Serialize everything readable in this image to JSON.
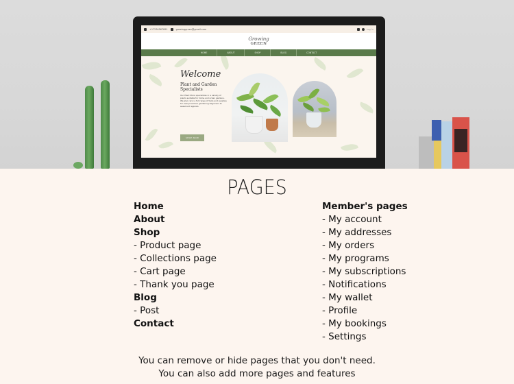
{
  "mockup": {
    "site": {
      "topbar": {
        "phone": "+17234567891",
        "email": "growinggreen@gmail.com",
        "login": "Log In"
      },
      "logo": {
        "script": "Growing",
        "word": "GREEN"
      },
      "nav": [
        "HOME",
        "ABOUT",
        "SHOP",
        "BLOG",
        "CONTACT"
      ],
      "hero": {
        "welcome": "Welcome",
        "subtitle": "Plant and Garden Specialists",
        "body": "Our Plant Store specializes in a variety of plants suitable for home and urban gardens. We also carry a full range of tools and supplies for everyone from gardening beginners to seasoned regulars.",
        "button": "SHOP NOW"
      },
      "colors": {
        "nav_green": "#5a7a4a",
        "button_sage": "#9aa982",
        "background_cream": "#fbf5ee"
      }
    }
  },
  "pages_title": "PAGES",
  "left_column": [
    {
      "label": "Home",
      "bold": true
    },
    {
      "label": "About",
      "bold": true
    },
    {
      "label": "Shop",
      "bold": true
    },
    {
      "label": "- Product page",
      "bold": false
    },
    {
      "label": "- Collections page",
      "bold": false
    },
    {
      "label": "- Cart page",
      "bold": false
    },
    {
      "label": "- Thank you page",
      "bold": false
    },
    {
      "label": "Blog",
      "bold": true
    },
    {
      "label": "- Post",
      "bold": false
    },
    {
      "label": "Contact",
      "bold": true
    }
  ],
  "right_column": [
    {
      "label": "Member's pages",
      "bold": true
    },
    {
      "label": "- My account",
      "bold": false
    },
    {
      "label": "- My addresses",
      "bold": false
    },
    {
      "label": "- My orders",
      "bold": false
    },
    {
      "label": "- My programs",
      "bold": false
    },
    {
      "label": "- My subscriptions",
      "bold": false
    },
    {
      "label": "- Notifications",
      "bold": false
    },
    {
      "label": "- My wallet",
      "bold": false
    },
    {
      "label": "- Profile",
      "bold": false
    },
    {
      "label": "- My bookings",
      "bold": false
    },
    {
      "label": "- Settings",
      "bold": false
    }
  ],
  "footer_note": {
    "line1": "You can remove or hide pages that you don't need.",
    "line2": "You can also add more pages and features"
  },
  "page_background": "#fdf5ef"
}
